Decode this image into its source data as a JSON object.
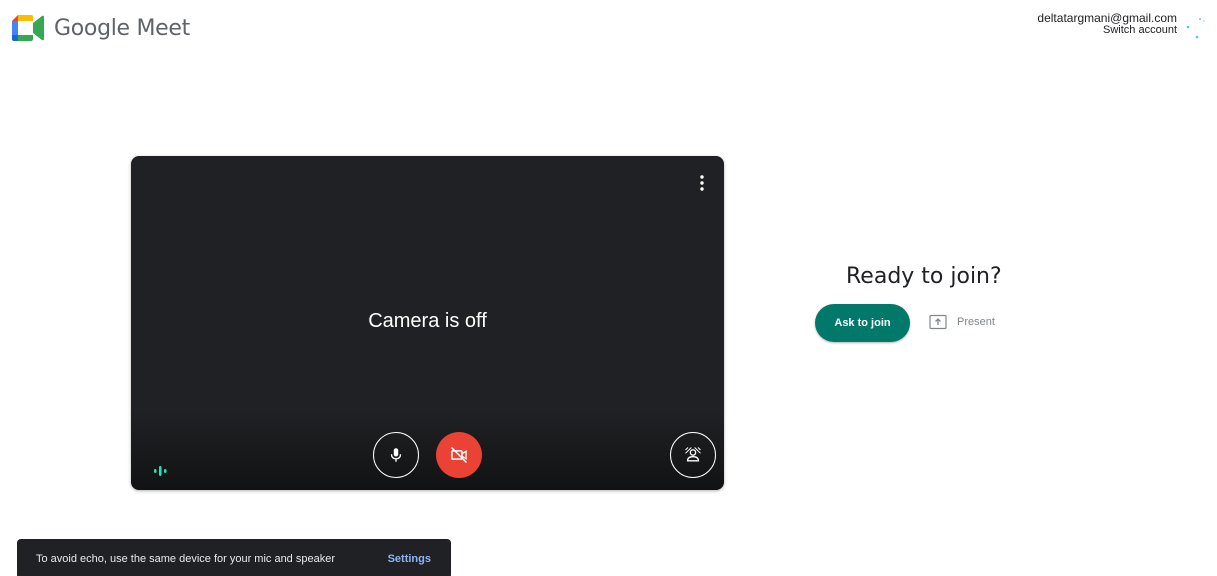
{
  "header": {
    "app_name": "Google Meet",
    "account_email": "deltatargmani@gmail.com",
    "switch_account_label": "Switch account"
  },
  "preview": {
    "status_text": "Camera is off",
    "more_options_icon": "more-vert-icon",
    "mic_icon": "mic-icon",
    "camera_icon": "videocam-off-icon",
    "effects_icon": "visual-effects-icon",
    "audio_indicator_icon": "audio-level-icon"
  },
  "join": {
    "title": "Ready to join?",
    "ask_button_label": "Ask to join",
    "present_label": "Present",
    "present_icon": "present-to-all-icon"
  },
  "snackbar": {
    "message": "To avoid echo, use the same device for your mic and speaker",
    "action_label": "Settings"
  },
  "colors": {
    "accent_green": "#00796b",
    "camera_off_red": "#ea4335",
    "preview_bg": "#202124",
    "snackbar_bg": "#202124"
  }
}
